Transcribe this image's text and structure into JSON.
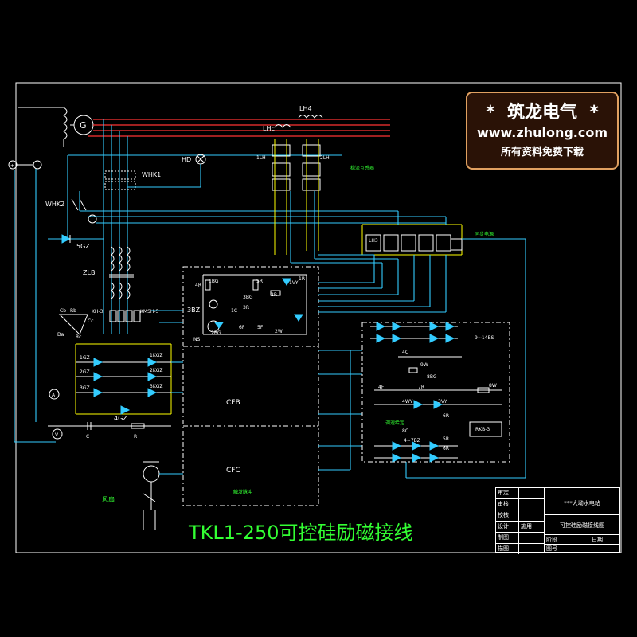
{
  "watermark": {
    "line1": "*  筑龙电气  *",
    "line2": "www.zhulong.com",
    "line3": "所有资料免费下载"
  },
  "title": "TKL1-250可控硅励磁接线",
  "labels": {
    "generator": "G",
    "lh4": "LH4",
    "lhc": "LHc",
    "lh1": "1LH",
    "lh2": "2LH",
    "hd": "HD",
    "whk1": "WHK1",
    "whk2": "WHK2",
    "gz5": "5GZ",
    "zlb": "ZLB",
    "kh3": "KH-3",
    "kmsh": "KMSH-5",
    "gz1": "1GZ",
    "gz2": "2GZ",
    "gz3": "3GZ",
    "kgz1": "1KGZ",
    "kgz2": "2KGZ",
    "kgz3": "3KGZ",
    "gz4": "4GZ",
    "c": "C",
    "r": "R",
    "bz3": "3BZ",
    "ns": "NS",
    "bg1": "1BG",
    "bg2": "2BG",
    "bg3": "3BG",
    "r4": "4R",
    "r5": "5R",
    "r1": "1R",
    "vy1": "1VY",
    "c1": "1C",
    "r3": "3R",
    "r2": "2R",
    "f6": "6F",
    "f5": "5F",
    "w2": "2W",
    "cfb": "CFB",
    "cfc": "CFC",
    "trigger": "触发脉冲",
    "fan": "风扇",
    "lh3": "LH3",
    "lh_panel": "稳流互感器",
    "sync": "同步电源",
    "phase": "9~14BS",
    "c4": "4C",
    "w9": "9W",
    "bg8": "8BG",
    "r7": "7R",
    "f4": "4F",
    "w8": "8W",
    "vy3": "3VY",
    "wy4": "4WY",
    "r6": "6R",
    "fb": "RKB-3",
    "protect": "调速给定",
    "c8": "8C",
    "bz478": "4~7BZ",
    "r8": "5R",
    "r9": "6R",
    "cb": "Cb",
    "rb": "Rb",
    "cc": "Cc",
    "da": "Da",
    "rc": "Rc"
  },
  "title_block": {
    "rows": [
      {
        "role": "审定",
        "name": ""
      },
      {
        "role": "审核",
        "name": ""
      },
      {
        "role": "校核",
        "name": ""
      },
      {
        "role": "设计",
        "name": "施用"
      },
      {
        "role": "制图",
        "name": ""
      },
      {
        "role": "描图",
        "name": ""
      }
    ],
    "project": "***大坳水电站",
    "drawing": "可控硅励磁接线图",
    "stage_label": "阶段",
    "date_label": "日期",
    "number_label": "图号"
  }
}
